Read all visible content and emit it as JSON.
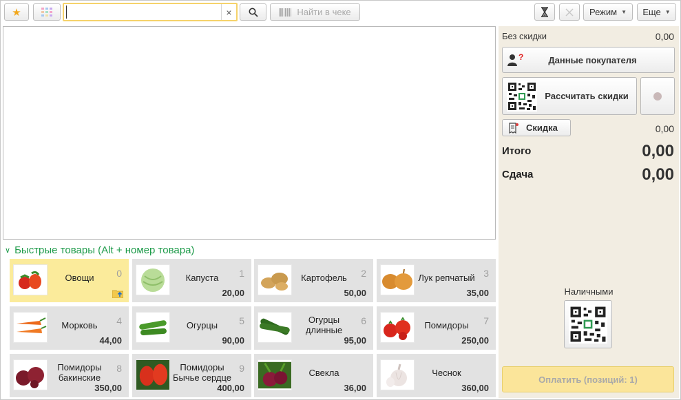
{
  "toolbar": {
    "search_value": "",
    "search_clear": "×",
    "find_in_receipt": "Найти в чеке",
    "mode": "Режим",
    "more": "Еще"
  },
  "quick_items": {
    "header": "Быстрые товары (Alt + номер товара)",
    "tiles": [
      {
        "name": "Овощи",
        "num": "0",
        "price": "",
        "icon": "tomato-pepper-icon"
      },
      {
        "name": "Капуста",
        "num": "1",
        "price": "20,00",
        "icon": "cabbage-icon"
      },
      {
        "name": "Картофель",
        "num": "2",
        "price": "50,00",
        "icon": "potato-icon"
      },
      {
        "name": "Лук репчатый",
        "num": "3",
        "price": "35,00",
        "icon": "onion-icon"
      },
      {
        "name": "Морковь",
        "num": "4",
        "price": "44,00",
        "icon": "carrot-icon"
      },
      {
        "name": "Огурцы",
        "num": "5",
        "price": "90,00",
        "icon": "cucumber-icon"
      },
      {
        "name": "Огурцы длинные",
        "num": "6",
        "price": "95,00",
        "icon": "long-cucumber-icon"
      },
      {
        "name": "Помидоры",
        "num": "7",
        "price": "250,00",
        "icon": "tomato-icon"
      },
      {
        "name": "Помидоры бакинские",
        "num": "8",
        "price": "350,00",
        "icon": "baku-tomato-icon"
      },
      {
        "name": "Помидоры Бычье сердце",
        "num": "9",
        "price": "400,00",
        "icon": "bull-heart-tomato-icon"
      },
      {
        "name": "Свекла",
        "num": "",
        "price": "36,00",
        "icon": "beet-icon"
      },
      {
        "name": "Чеснок",
        "num": "",
        "price": "360,00",
        "icon": "garlic-icon"
      }
    ]
  },
  "panel": {
    "no_discount_label": "Без скидки",
    "no_discount_value": "0,00",
    "customer_data": "Данные покупателя",
    "calc_discounts": "Рассчитать скидки",
    "discount_btn": "Скидка",
    "discount_value": "0,00",
    "total_label": "Итого",
    "total_value": "0,00",
    "change_label": "Сдача",
    "change_value": "0,00",
    "cash_label": "Наличными",
    "pay_btn": "Оплатить (позиций: 1)"
  },
  "colors": {
    "accent_green": "#1e9b4a",
    "selected_tile": "#fbeb9b",
    "pay_button": "#fbe59a",
    "panel_bg": "#f2ede2"
  }
}
